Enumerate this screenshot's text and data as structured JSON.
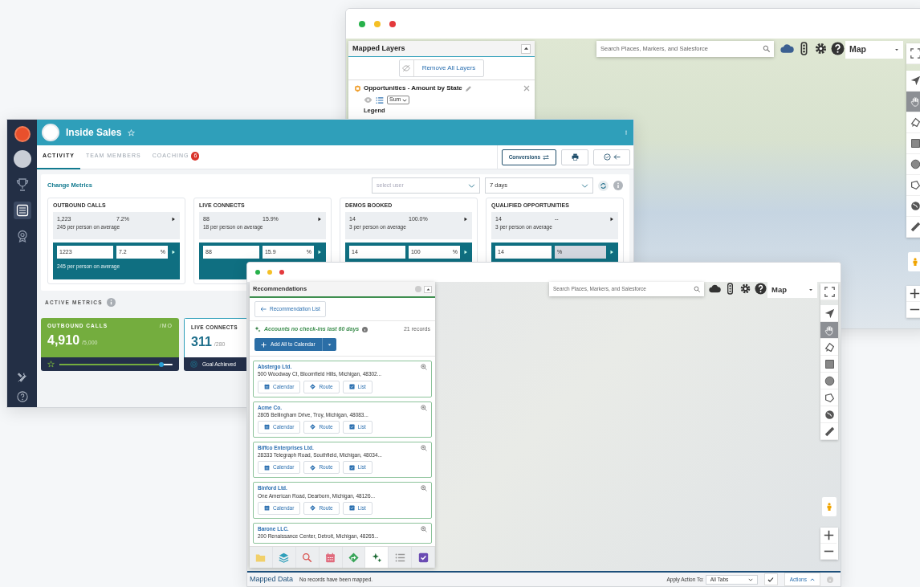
{
  "back_window": {
    "mapped_layers": {
      "title": "Mapped Layers",
      "remove_button": "Remove All Layers",
      "layer": {
        "name": "Opportunities - Amount by State",
        "aggregate": "Sum",
        "legend_label": "Legend"
      }
    },
    "search": {
      "placeholder": "Search Places, Markers, and Salesforce"
    },
    "map_type": "Map",
    "map_tools": [
      {
        "kind": "fullscreen",
        "selected": false
      },
      {
        "kind": "locate",
        "selected": false
      },
      {
        "kind": "hand",
        "selected": true
      },
      {
        "kind": "lasso",
        "selected": false
      },
      {
        "kind": "rectangle",
        "selected": false
      },
      {
        "kind": "circle",
        "selected": false
      },
      {
        "kind": "polygon",
        "selected": false
      },
      {
        "kind": "globe",
        "selected": false
      },
      {
        "kind": "ruler",
        "selected": false
      }
    ]
  },
  "inside_sales": {
    "title": "Inside Sales",
    "sidebar": [
      {
        "kind": "trophy",
        "selected": false
      },
      {
        "kind": "list",
        "selected": true
      },
      {
        "kind": "badge",
        "selected": false
      }
    ],
    "tabs": [
      {
        "label": "ACTIVITY",
        "selected": true
      },
      {
        "label": "TEAM MEMBERS",
        "selected": false
      },
      {
        "label": "COACHING",
        "selected": false,
        "badge": "6"
      }
    ],
    "conversions_button": "Conversions",
    "change_metrics": "Change Metrics",
    "user_select": {
      "placeholder": "select user"
    },
    "period_select": {
      "value": "7 days"
    },
    "metrics": [
      {
        "title": "OUTBOUND CALLS",
        "value": "1,223",
        "change": "7.2%",
        "average": "245 per person on average",
        "input_value": "1223",
        "input_percent": "7.2",
        "percent_sign": "%",
        "percent_disabled": false,
        "input_average": "245 per person on average"
      },
      {
        "title": "LIVE CONNECTS",
        "value": "88",
        "change": "15.9%",
        "average": "18 per person on average",
        "input_value": "88",
        "input_percent": "15.9",
        "percent_sign": "%",
        "percent_disabled": false
      },
      {
        "title": "DEMOS BOOKED",
        "value": "14",
        "change": "100.0%",
        "average": "3 per person on average",
        "input_value": "14",
        "input_percent": "100",
        "percent_sign": "%",
        "percent_disabled": false
      },
      {
        "title": "QUALIFIED OPPORTUNITIES",
        "value": "14",
        "change": "--",
        "average": "3 per person on average",
        "input_value": "14",
        "percent_sign": "%",
        "percent_disabled": true
      }
    ],
    "active_metrics_title": "ACTIVE METRICS",
    "goals": [
      {
        "kind": "progress",
        "title": "OUTBOUND CALLS",
        "period": "/MO",
        "value": "4,910",
        "target": "/5,000",
        "level": 0.9
      },
      {
        "kind": "achieved",
        "title": "LIVE CONNECTS",
        "value": "311",
        "target": "/280",
        "status": "Goal Achieved"
      }
    ]
  },
  "front_window": {
    "panel": {
      "title": "Recommendations",
      "back_button": "Recommendation List",
      "filter_title": "Accounts no check-ins last 60 days",
      "record_count": "21 records",
      "add_button": "Add All to Calendar",
      "accounts": [
        {
          "name": "Abstergo Ltd.",
          "address": "500 Woodway Ct, Bloomfield Hills, Michigan, 48302...",
          "actions": [
            "Calendar",
            "Route",
            "List"
          ]
        },
        {
          "name": "Acme Co.",
          "address": "2805 Bellingham Drive, Troy, Michigan, 48083...",
          "actions": [
            "Calendar",
            "Route",
            "List"
          ]
        },
        {
          "name": "Biffco Enterprises Ltd.",
          "address": "28333 Telegraph Road, Southfield, Michigan, 48034...",
          "actions": [
            "Calendar",
            "Route",
            "List"
          ]
        },
        {
          "name": "Binford Ltd.",
          "address": "One American Road, Dearborn, Michigan, 48126...",
          "actions": [
            "Calendar",
            "Route",
            "List"
          ]
        },
        {
          "name": "Barone LLC.",
          "address": "200 Renaissance Center, Detroit, Michigan, 48265..."
        }
      ],
      "toolbar": [
        {
          "kind": "folder",
          "selected": false
        },
        {
          "kind": "layers",
          "selected": false
        },
        {
          "kind": "search",
          "selected": false
        },
        {
          "kind": "calendar",
          "selected": false
        },
        {
          "kind": "route",
          "selected": false
        },
        {
          "kind": "sparkle",
          "selected": true
        },
        {
          "kind": "list",
          "selected": false
        },
        {
          "kind": "check",
          "selected": false
        }
      ]
    },
    "search": {
      "placeholder": "Search Places, Markers, and Salesforce"
    },
    "map_type": "Map",
    "map_tools": [
      {
        "kind": "fullscreen",
        "selected": false
      },
      {
        "kind": "locate",
        "selected": false
      },
      {
        "kind": "hand",
        "selected": true
      },
      {
        "kind": "lasso",
        "selected": false
      },
      {
        "kind": "rectangle",
        "selected": false
      },
      {
        "kind": "circle",
        "selected": false
      },
      {
        "kind": "polygon",
        "selected": false
      },
      {
        "kind": "globe",
        "selected": false
      },
      {
        "kind": "ruler",
        "selected": false
      }
    ],
    "bottom_bar": {
      "title": "Mapped Data",
      "message": "No records have been mapped.",
      "apply_label": "Apply Action To:",
      "apply_value": "All Tabs",
      "actions_button": "Actions"
    }
  }
}
